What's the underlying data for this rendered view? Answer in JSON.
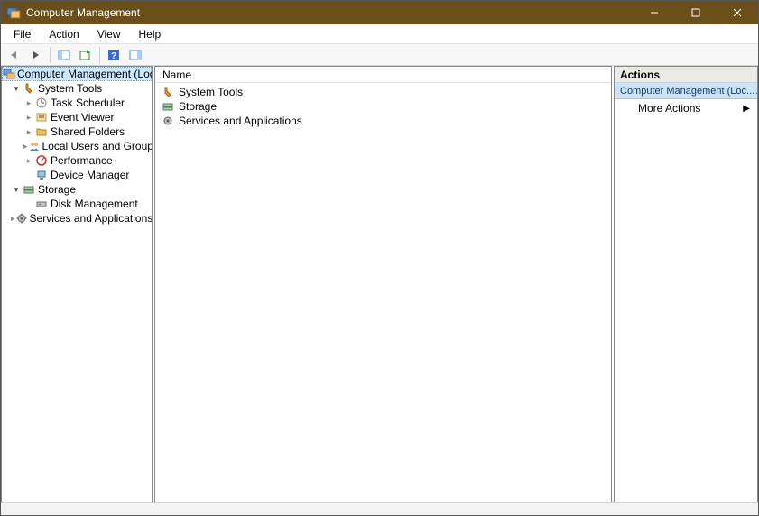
{
  "window": {
    "title": "Computer Management"
  },
  "menubar": {
    "items": [
      "File",
      "Action",
      "View",
      "Help"
    ]
  },
  "toolbar": {
    "buttons": [
      "back",
      "forward",
      "show-hide-tree",
      "export-list",
      "refresh",
      "help",
      "show-hide-action-pane"
    ]
  },
  "tree": {
    "root": {
      "label": "Computer Management (Local)",
      "icon": "computer-mgmt",
      "selected": true,
      "expanded": true
    },
    "nodes": [
      {
        "label": "System Tools",
        "icon": "system-tools",
        "expanded": true,
        "level": 1,
        "children": [
          {
            "label": "Task Scheduler",
            "icon": "task-scheduler",
            "hasChildren": true
          },
          {
            "label": "Event Viewer",
            "icon": "event-viewer",
            "hasChildren": true
          },
          {
            "label": "Shared Folders",
            "icon": "shared-folders",
            "hasChildren": true
          },
          {
            "label": "Local Users and Groups",
            "icon": "users-groups",
            "hasChildren": true
          },
          {
            "label": "Performance",
            "icon": "performance",
            "hasChildren": true
          },
          {
            "label": "Device Manager",
            "icon": "device-manager",
            "hasChildren": false
          }
        ]
      },
      {
        "label": "Storage",
        "icon": "storage",
        "expanded": true,
        "level": 1,
        "children": [
          {
            "label": "Disk Management",
            "icon": "disk-management",
            "hasChildren": false
          }
        ]
      },
      {
        "label": "Services and Applications",
        "icon": "services",
        "expanded": false,
        "level": 1,
        "hasChildren": true
      }
    ]
  },
  "list": {
    "header": "Name",
    "items": [
      {
        "label": "System Tools",
        "icon": "system-tools"
      },
      {
        "label": "Storage",
        "icon": "storage"
      },
      {
        "label": "Services and Applications",
        "icon": "services"
      }
    ]
  },
  "actions": {
    "header": "Actions",
    "context": "Computer Management (Loc...",
    "items": [
      {
        "label": "More Actions",
        "hasSubmenu": true
      }
    ]
  }
}
